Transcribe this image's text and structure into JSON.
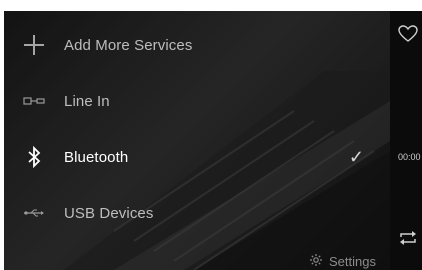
{
  "menu": {
    "items": [
      {
        "label": "Add More Services",
        "icon": "plus-icon",
        "active": false
      },
      {
        "label": "Line In",
        "icon": "line-in-icon",
        "active": false
      },
      {
        "label": "Bluetooth",
        "icon": "bluetooth-icon",
        "active": true,
        "checked": true
      },
      {
        "label": "USB Devices",
        "icon": "usb-icon",
        "active": false
      }
    ],
    "check_icon": "✓"
  },
  "footer": {
    "settings_label": "Settings",
    "settings_icon": "gear-icon"
  },
  "side": {
    "time": "00:00",
    "heart_icon": "heart-icon",
    "repeat_icon": "repeat-icon"
  },
  "colors": {
    "background": "#101010",
    "text": "#bdbdbd",
    "active_text": "#ffffff",
    "icon": "#9a9a9a"
  }
}
